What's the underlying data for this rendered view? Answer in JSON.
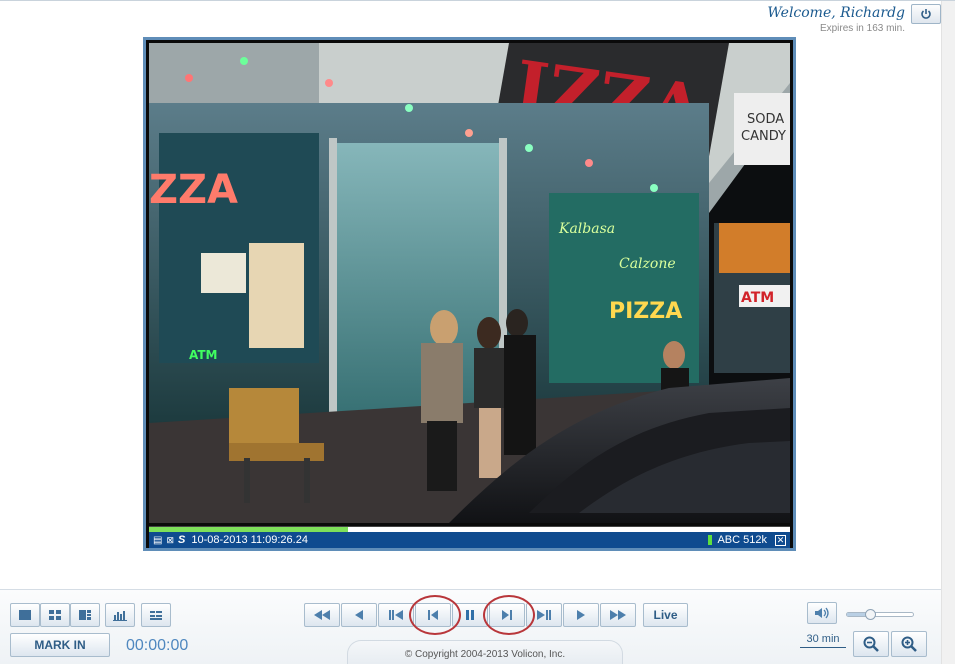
{
  "header": {
    "welcome": "Welcome, Richardg",
    "expires": "Expires in 163 min."
  },
  "video": {
    "timestamp": "10-08-2013 11:09:26.24",
    "stream_info": "ABC 512k",
    "progress_fraction": 0.31
  },
  "toolbar": {
    "layout_buttons": [
      "single-view-icon",
      "quad-view-icon",
      "grid-view-icon",
      "bar-chart-icon",
      "list-view-icon"
    ],
    "mark_in_label": "MARK IN",
    "timecode": "00:00:00",
    "transport_buttons": [
      "fast-rewind-icon",
      "step-back-icon",
      "skip-to-start-icon",
      "previous-frame-icon",
      "pause-icon",
      "next-frame-icon",
      "skip-to-end-icon",
      "play-icon",
      "fast-forward-icon"
    ],
    "live_label": "Live",
    "copyright": "© Copyright 2004-2013 Volicon, Inc.",
    "volume_level": 0.35,
    "zoom_label": "30 min"
  },
  "colors": {
    "accent": "#1b5a8f",
    "status_bar": "#0f4b8f",
    "highlight_ring": "#b8363a",
    "progress": "#7ee05a"
  }
}
